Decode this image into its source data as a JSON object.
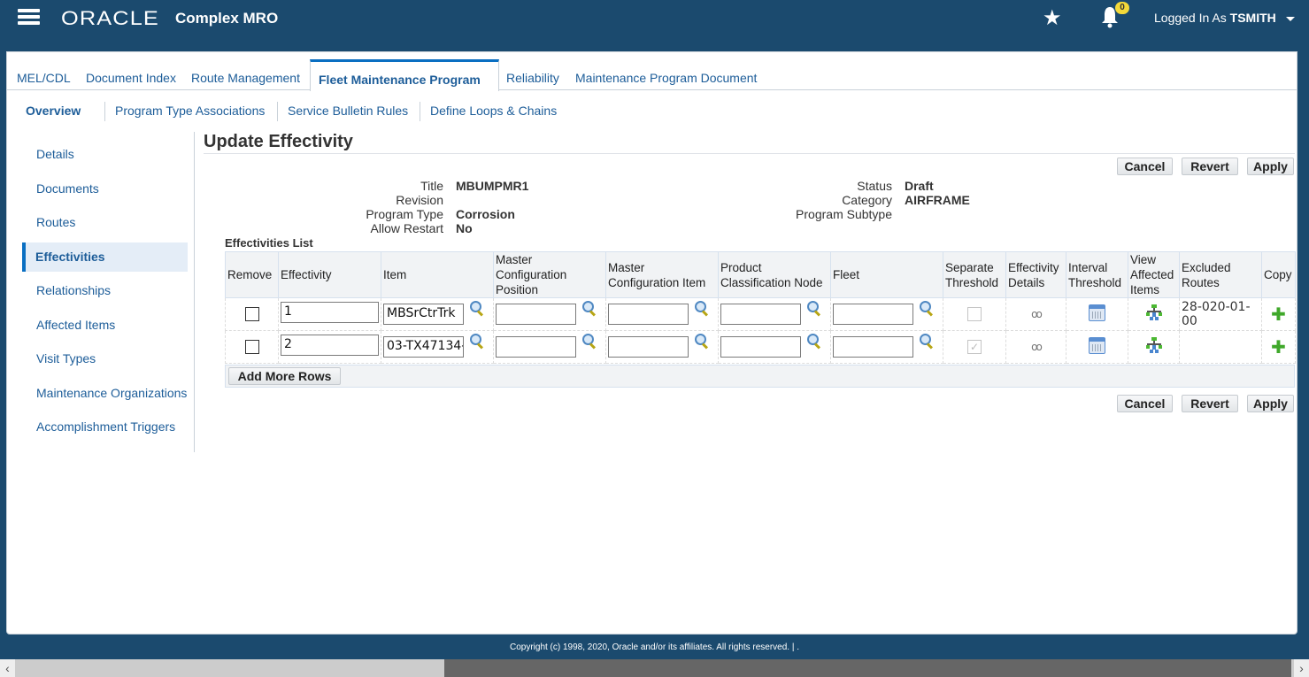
{
  "header": {
    "logo": "ORACLE",
    "app_title": "Complex MRO",
    "notification_count": "0",
    "logged_in_prefix": "Logged In As",
    "username": "TSMITH"
  },
  "tabs": [
    {
      "label": "MEL/CDL"
    },
    {
      "label": "Document Index"
    },
    {
      "label": "Route Management"
    },
    {
      "label": "Fleet Maintenance Program",
      "active": true
    },
    {
      "label": "Reliability"
    },
    {
      "label": "Maintenance Program Document"
    }
  ],
  "subnav": [
    {
      "label": "Overview",
      "active": true
    },
    {
      "label": "Program Type Associations"
    },
    {
      "label": "Service Bulletin Rules"
    },
    {
      "label": "Define Loops & Chains"
    }
  ],
  "sidebar": {
    "items": [
      {
        "label": "Details"
      },
      {
        "label": "Documents"
      },
      {
        "label": "Routes"
      },
      {
        "label": "Effectivities",
        "active": true
      },
      {
        "label": "Relationships"
      },
      {
        "label": "Affected Items"
      },
      {
        "label": "Visit Types"
      },
      {
        "label": "Maintenance Organizations"
      },
      {
        "label": "Accomplishment Triggers"
      }
    ]
  },
  "page": {
    "title": "Update Effectivity",
    "buttons": {
      "cancel": "Cancel",
      "revert": "Revert",
      "apply": "Apply"
    },
    "fields_left": [
      {
        "label": "Title",
        "value": "MBUMPMR1"
      },
      {
        "label": "Revision",
        "value": ""
      },
      {
        "label": "Program Type",
        "value": "Corrosion"
      },
      {
        "label": "Allow Restart",
        "value": "No"
      }
    ],
    "fields_right": [
      {
        "label": "Status",
        "value": "Draft"
      },
      {
        "label": "Category",
        "value": "AIRFRAME"
      },
      {
        "label": "Program Subtype",
        "value": ""
      }
    ],
    "list_title": "Effectivities List",
    "add_rows_label": "Add More Rows"
  },
  "table": {
    "columns": [
      "Remove",
      "Effectivity",
      "Item",
      "Master Configuration Position",
      "Master Configuration Item",
      "Product Classification Node",
      "Fleet",
      "Separate Threshold",
      "Effectivity Details",
      "Interval Threshold",
      "View Affected Items",
      "Excluded Routes",
      "Copy"
    ],
    "rows": [
      {
        "remove": false,
        "effectivity": "1",
        "item": "MBSrCtrTrk",
        "mc_position": "",
        "mc_item": "",
        "pc_node": "",
        "fleet": "",
        "separate_threshold": false,
        "excluded_routes": "28-020-01-00"
      },
      {
        "remove": false,
        "effectivity": "2",
        "item": "03-TX47134-",
        "mc_position": "",
        "mc_item": "",
        "pc_node": "",
        "fleet": "",
        "separate_threshold": true,
        "excluded_routes": ""
      }
    ]
  },
  "footer": {
    "copyright": "Copyright (c) 1998, 2020, Oracle and/or its affiliates. All rights reserved. | ."
  }
}
